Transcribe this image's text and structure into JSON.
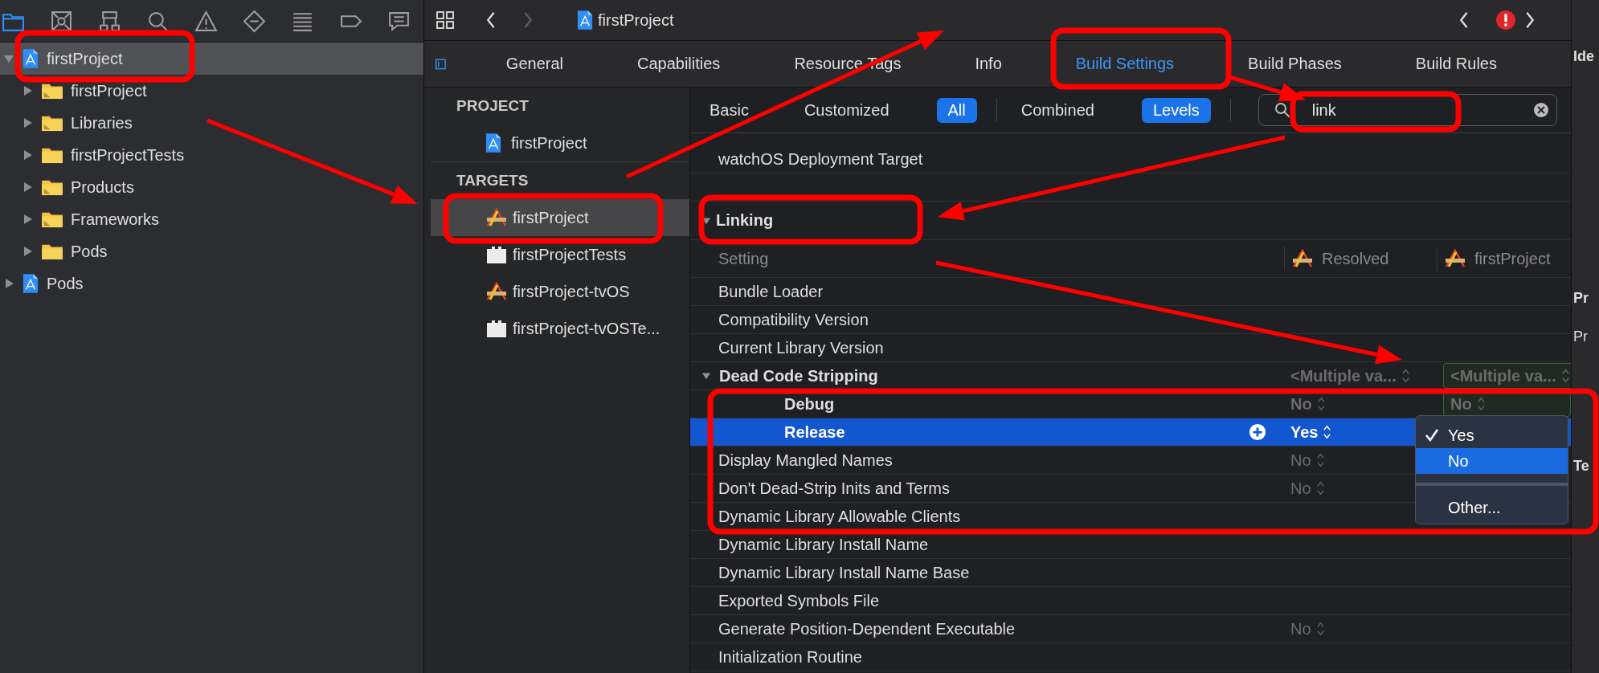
{
  "navigator": {
    "toolbar": [
      {
        "selected": true
      },
      {
        "selected": false
      },
      {
        "selected": false
      },
      {
        "selected": false
      },
      {
        "selected": false
      },
      {
        "selected": false
      },
      {
        "selected": false
      },
      {
        "selected": false
      },
      {
        "selected": false
      }
    ],
    "tree": [
      {
        "label": "firstProject",
        "kind": "project",
        "expanded": true,
        "selected": true,
        "children": [
          {
            "label": "firstProject",
            "kind": "group",
            "expanded": false,
            "selected": false
          },
          {
            "label": "Libraries",
            "kind": "group",
            "expanded": false,
            "selected": false
          },
          {
            "label": "firstProjectTests",
            "kind": "folder",
            "expanded": false,
            "selected": false
          },
          {
            "label": "Products",
            "kind": "group",
            "expanded": false,
            "selected": false
          },
          {
            "label": "Frameworks",
            "kind": "group",
            "expanded": false,
            "selected": false
          },
          {
            "label": "Pods",
            "kind": "folder",
            "expanded": false,
            "selected": false
          }
        ]
      },
      {
        "label": "Pods",
        "kind": "project",
        "expanded": false,
        "selected": false
      }
    ]
  },
  "title_bar": {
    "title": "firstProject",
    "forward_enabled": false
  },
  "editor_tabs": [
    {
      "label": "General",
      "selected": false
    },
    {
      "label": "Capabilities",
      "selected": false
    },
    {
      "label": "Resource Tags",
      "selected": false
    },
    {
      "label": "Info",
      "selected": false
    },
    {
      "label": "Build Settings",
      "selected": true
    },
    {
      "label": "Build Phases",
      "selected": false
    },
    {
      "label": "Build Rules",
      "selected": false
    }
  ],
  "project_list": [
    {
      "heading": "PROJECT",
      "items": [
        {
          "label": "firstProject",
          "kind": "project",
          "selected": false
        }
      ]
    },
    {
      "heading": "TARGETS",
      "items": [
        {
          "label": "firstProject",
          "kind": "app",
          "selected": true
        },
        {
          "label": "firstProjectTests",
          "kind": "bundle",
          "selected": false
        },
        {
          "label": "firstProject-tvOS",
          "kind": "app",
          "selected": false
        },
        {
          "label": "firstProject-tvOSTe...",
          "kind": "bundle",
          "selected": false
        }
      ]
    }
  ],
  "filter_bar": {
    "scope": [
      {
        "label": "Basic",
        "selected": false
      },
      {
        "label": "Customized",
        "selected": false
      },
      {
        "label": "All",
        "selected": true
      }
    ],
    "view": [
      {
        "label": "Combined",
        "selected": false
      },
      {
        "label": "Levels",
        "selected": true
      }
    ],
    "search": {
      "value": "link"
    }
  },
  "settings": {
    "above": [
      {
        "name": "watchOS Deployment Target"
      }
    ],
    "section": {
      "title": "Linking",
      "expanded": true
    },
    "columns": [
      "Setting",
      "Resolved",
      "firstProject"
    ],
    "rows": [
      {
        "kind": "setting",
        "name": "Bundle Loader"
      },
      {
        "kind": "setting",
        "name": "Compatibility Version"
      },
      {
        "kind": "setting",
        "name": "Current Library Version"
      },
      {
        "kind": "group",
        "name": "Dead Code Stripping",
        "expanded": true,
        "resolved": "<Multiple va...",
        "target": "<Multiple va..."
      },
      {
        "kind": "config",
        "name": "Debug",
        "resolved": "No",
        "target": "No",
        "selected": false
      },
      {
        "kind": "config",
        "name": "Release",
        "resolved": "Yes",
        "selected": true
      },
      {
        "kind": "setting",
        "name": "Display Mangled Names",
        "resolved": "No"
      },
      {
        "kind": "setting",
        "name": "Don't Dead-Strip Inits and Terms",
        "resolved": "No"
      },
      {
        "kind": "setting",
        "name": "Dynamic Library Allowable Clients"
      },
      {
        "kind": "setting",
        "name": "Dynamic Library Install Name"
      },
      {
        "kind": "setting",
        "name": "Dynamic Library Install Name Base"
      },
      {
        "kind": "setting",
        "name": "Exported Symbols File"
      },
      {
        "kind": "setting",
        "name": "Generate Position-Dependent Executable",
        "resolved": "No"
      },
      {
        "kind": "setting",
        "name": "Initialization Routine"
      }
    ]
  },
  "popup_menu": [
    {
      "kind": "item",
      "label": "Yes",
      "checked": true,
      "selected": false
    },
    {
      "kind": "item",
      "label": "No",
      "checked": false,
      "selected": true
    },
    {
      "kind": "separator"
    },
    {
      "kind": "item",
      "label": "Other...",
      "checked": false,
      "selected": false
    }
  ],
  "inspector": [
    {
      "text": "Ide",
      "kind": "heading"
    },
    {
      "text": "Pr",
      "kind": "heading"
    },
    {
      "text": "Pr",
      "kind": "label"
    },
    {
      "text": "Te",
      "kind": "heading"
    }
  ]
}
